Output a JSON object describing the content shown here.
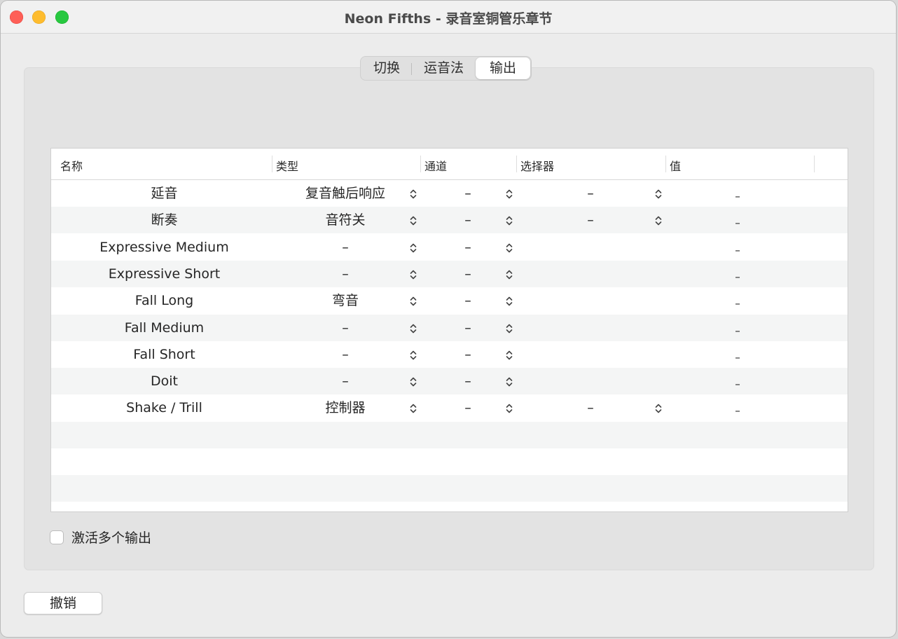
{
  "window": {
    "title": "Neon Fifths - 录音室铜管乐章节"
  },
  "tabs": [
    {
      "label": "切换",
      "active": false
    },
    {
      "label": "运音法",
      "active": false
    },
    {
      "label": "输出",
      "active": true
    }
  ],
  "table": {
    "columns": [
      "名称",
      "类型",
      "通道",
      "选择器",
      "值"
    ],
    "rows": [
      {
        "name": "延音",
        "type": "复音触后响应",
        "channel": "–",
        "selector": "–",
        "value": "–"
      },
      {
        "name": "断奏",
        "type": "音符关",
        "channel": "–",
        "selector": "–",
        "value": "–"
      },
      {
        "name": "Expressive Medium",
        "type": "–",
        "channel": "–",
        "selector": "",
        "value": "–"
      },
      {
        "name": "Expressive Short",
        "type": "–",
        "channel": "–",
        "selector": "",
        "value": "–"
      },
      {
        "name": "Fall Long",
        "type": "弯音",
        "channel": "–",
        "selector": "",
        "value": "–"
      },
      {
        "name": "Fall Medium",
        "type": "–",
        "channel": "–",
        "selector": "",
        "value": "–"
      },
      {
        "name": "Fall Short",
        "type": "–",
        "channel": "–",
        "selector": "",
        "value": "–"
      },
      {
        "name": "Doit",
        "type": "–",
        "channel": "–",
        "selector": "",
        "value": "–"
      },
      {
        "name": "Shake / Trill",
        "type": "控制器",
        "channel": "–",
        "selector": "–",
        "value": "–"
      }
    ],
    "empty_rows": 3
  },
  "options": {
    "multiple_outputs_label": "激活多个输出",
    "multiple_outputs_checked": false
  },
  "footer": {
    "cancel_label": "撤销"
  },
  "colors": {
    "close": "#fe5f57",
    "minimize": "#febc2e",
    "zoom": "#28c840"
  }
}
